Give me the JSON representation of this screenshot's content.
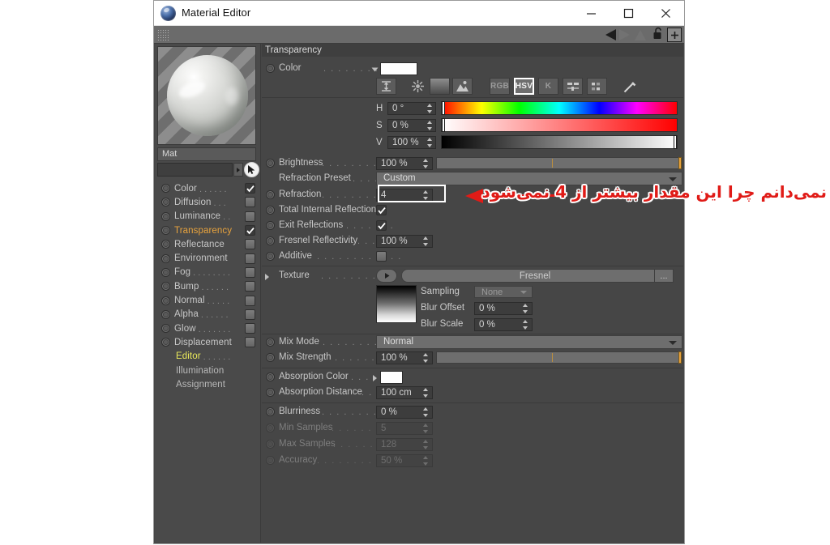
{
  "window": {
    "title": "Material Editor",
    "controls": {
      "minimize": "—",
      "maximize": "□",
      "close": "✕"
    }
  },
  "toolbar": {
    "back_icon": "triangle-left-icon",
    "forward_icon": "triangle-right-icon",
    "lock_icon": "unlocked-padlock-icon",
    "add_icon": "plus-icon"
  },
  "sidebar": {
    "material_name": "Mat",
    "name_field_value": "",
    "channels": [
      {
        "label": "Color",
        "dots": ". . . . . .",
        "checked": true,
        "highlight": false
      },
      {
        "label": "Diffusion",
        "dots": ". . .",
        "checked": false,
        "highlight": false
      },
      {
        "label": "Luminance",
        "dots": ". .",
        "checked": false,
        "highlight": false
      },
      {
        "label": "Transparency",
        "dots": "",
        "checked": true,
        "highlight": true
      },
      {
        "label": "Reflectance",
        "dots": "",
        "checked": false,
        "highlight": false
      },
      {
        "label": "Environment",
        "dots": "",
        "checked": false,
        "highlight": false
      },
      {
        "label": "Fog",
        "dots": ". . . . . . . .",
        "checked": false,
        "highlight": false
      },
      {
        "label": "Bump",
        "dots": ". . . . . .",
        "checked": false,
        "highlight": false
      },
      {
        "label": "Normal",
        "dots": ". . . . .",
        "checked": false,
        "highlight": false
      },
      {
        "label": "Alpha",
        "dots": ". . . . . .",
        "checked": false,
        "highlight": false
      },
      {
        "label": "Glow",
        "dots": ". . . . . . .",
        "checked": false,
        "highlight": false
      },
      {
        "label": "Displacement",
        "dots": "",
        "checked": false,
        "highlight": false
      }
    ],
    "sub_items": [
      {
        "label": "Editor",
        "dots": ". . . . . .",
        "selected": true
      },
      {
        "label": "Illumination",
        "dots": "",
        "selected": false
      },
      {
        "label": "Assignment",
        "dots": "",
        "selected": false
      }
    ]
  },
  "panel": {
    "section_title": "Transparency",
    "color": {
      "label": "Color",
      "dots": ". . . . . . . . . . . .",
      "swatch_hex": "#ffffff",
      "mode_buttons": [
        {
          "name": "range-icon",
          "label": "",
          "active": false
        },
        {
          "name": "color-wheel-icon",
          "label": "",
          "active": false
        },
        {
          "name": "gradient-icon",
          "label": "",
          "active": false
        },
        {
          "name": "image-picker-icon",
          "label": "",
          "active": false
        },
        {
          "name": "rgb-mode",
          "label": "RGB",
          "active": false
        },
        {
          "name": "hsv-mode",
          "label": "HSV",
          "active": true
        },
        {
          "name": "kelvin-mode",
          "label": "K",
          "active": false
        },
        {
          "name": "sliders-icon",
          "label": "",
          "active": false
        },
        {
          "name": "swatches-icon",
          "label": "",
          "active": false
        },
        {
          "name": "eyedropper-icon",
          "label": "",
          "active": false
        }
      ],
      "channels": [
        {
          "key": "H",
          "value": "0 °",
          "handle_pct": 0
        },
        {
          "key": "S",
          "value": "0 %",
          "handle_pct": 0
        },
        {
          "key": "V",
          "value": "100 %",
          "handle_pct": 100
        }
      ]
    },
    "rows": [
      {
        "label": "Brightness",
        "dots": ". . . . . . . . . . .",
        "value": "100 %"
      },
      {
        "label": "Refraction Preset",
        "dots": ". . . . . .",
        "value": "Custom"
      },
      {
        "label": "Refraction",
        "dots": ". . . . . . . . . . .",
        "value": "4"
      },
      {
        "label": "Total Internal Reflection",
        "dots": "",
        "value": ""
      },
      {
        "label": "Exit Reflections",
        "dots": ". . . . . . .",
        "value": ""
      },
      {
        "label": "Fresnel Reflectivity",
        "dots": ". . . .",
        "value": "100 %"
      },
      {
        "label": "Additive",
        "dots": ". . . . . . . . . . . .",
        "value": ""
      },
      {
        "label": "Texture",
        "dots": ". . . . . . . . . . . . .",
        "value": "Fresnel"
      },
      {
        "label": "Mix Mode",
        "dots": ". . . . . . . . . . .",
        "value": "Normal"
      },
      {
        "label": "Mix Strength",
        "dots": ". . . . . . . . .",
        "value": "100 %"
      },
      {
        "label": "Absorption Color",
        "dots": ". . .",
        "value": ""
      },
      {
        "label": "Absorption Distance",
        "dots": ". . .",
        "value": "100 cm"
      },
      {
        "label": "Blurriness",
        "dots": ". . . . . . . . . . .",
        "value": "0 %"
      },
      {
        "label": "Min Samples",
        "dots": ". . . . . . . . .",
        "value": "5"
      },
      {
        "label": "Max Samples",
        "dots": ". . . . . . . . .",
        "value": "128"
      },
      {
        "label": "Accuracy",
        "dots": ". . . . . . . . . . . .",
        "value": "50 %"
      }
    ],
    "texture_options": {
      "sampling_label": "Sampling",
      "sampling_value": "None",
      "blur_offset_label": "Blur Offset",
      "blur_offset_value": "0 %",
      "blur_scale_label": "Blur Scale",
      "blur_scale_value": "0 %",
      "browse_label": "..."
    },
    "absorption_swatch_hex": "#ffffff"
  },
  "annotation": {
    "text": "نمی‌دانم چرا این مقدار بیشتر از 4 نمی‌شود",
    "color": "#e01b17",
    "target": "Refraction"
  }
}
